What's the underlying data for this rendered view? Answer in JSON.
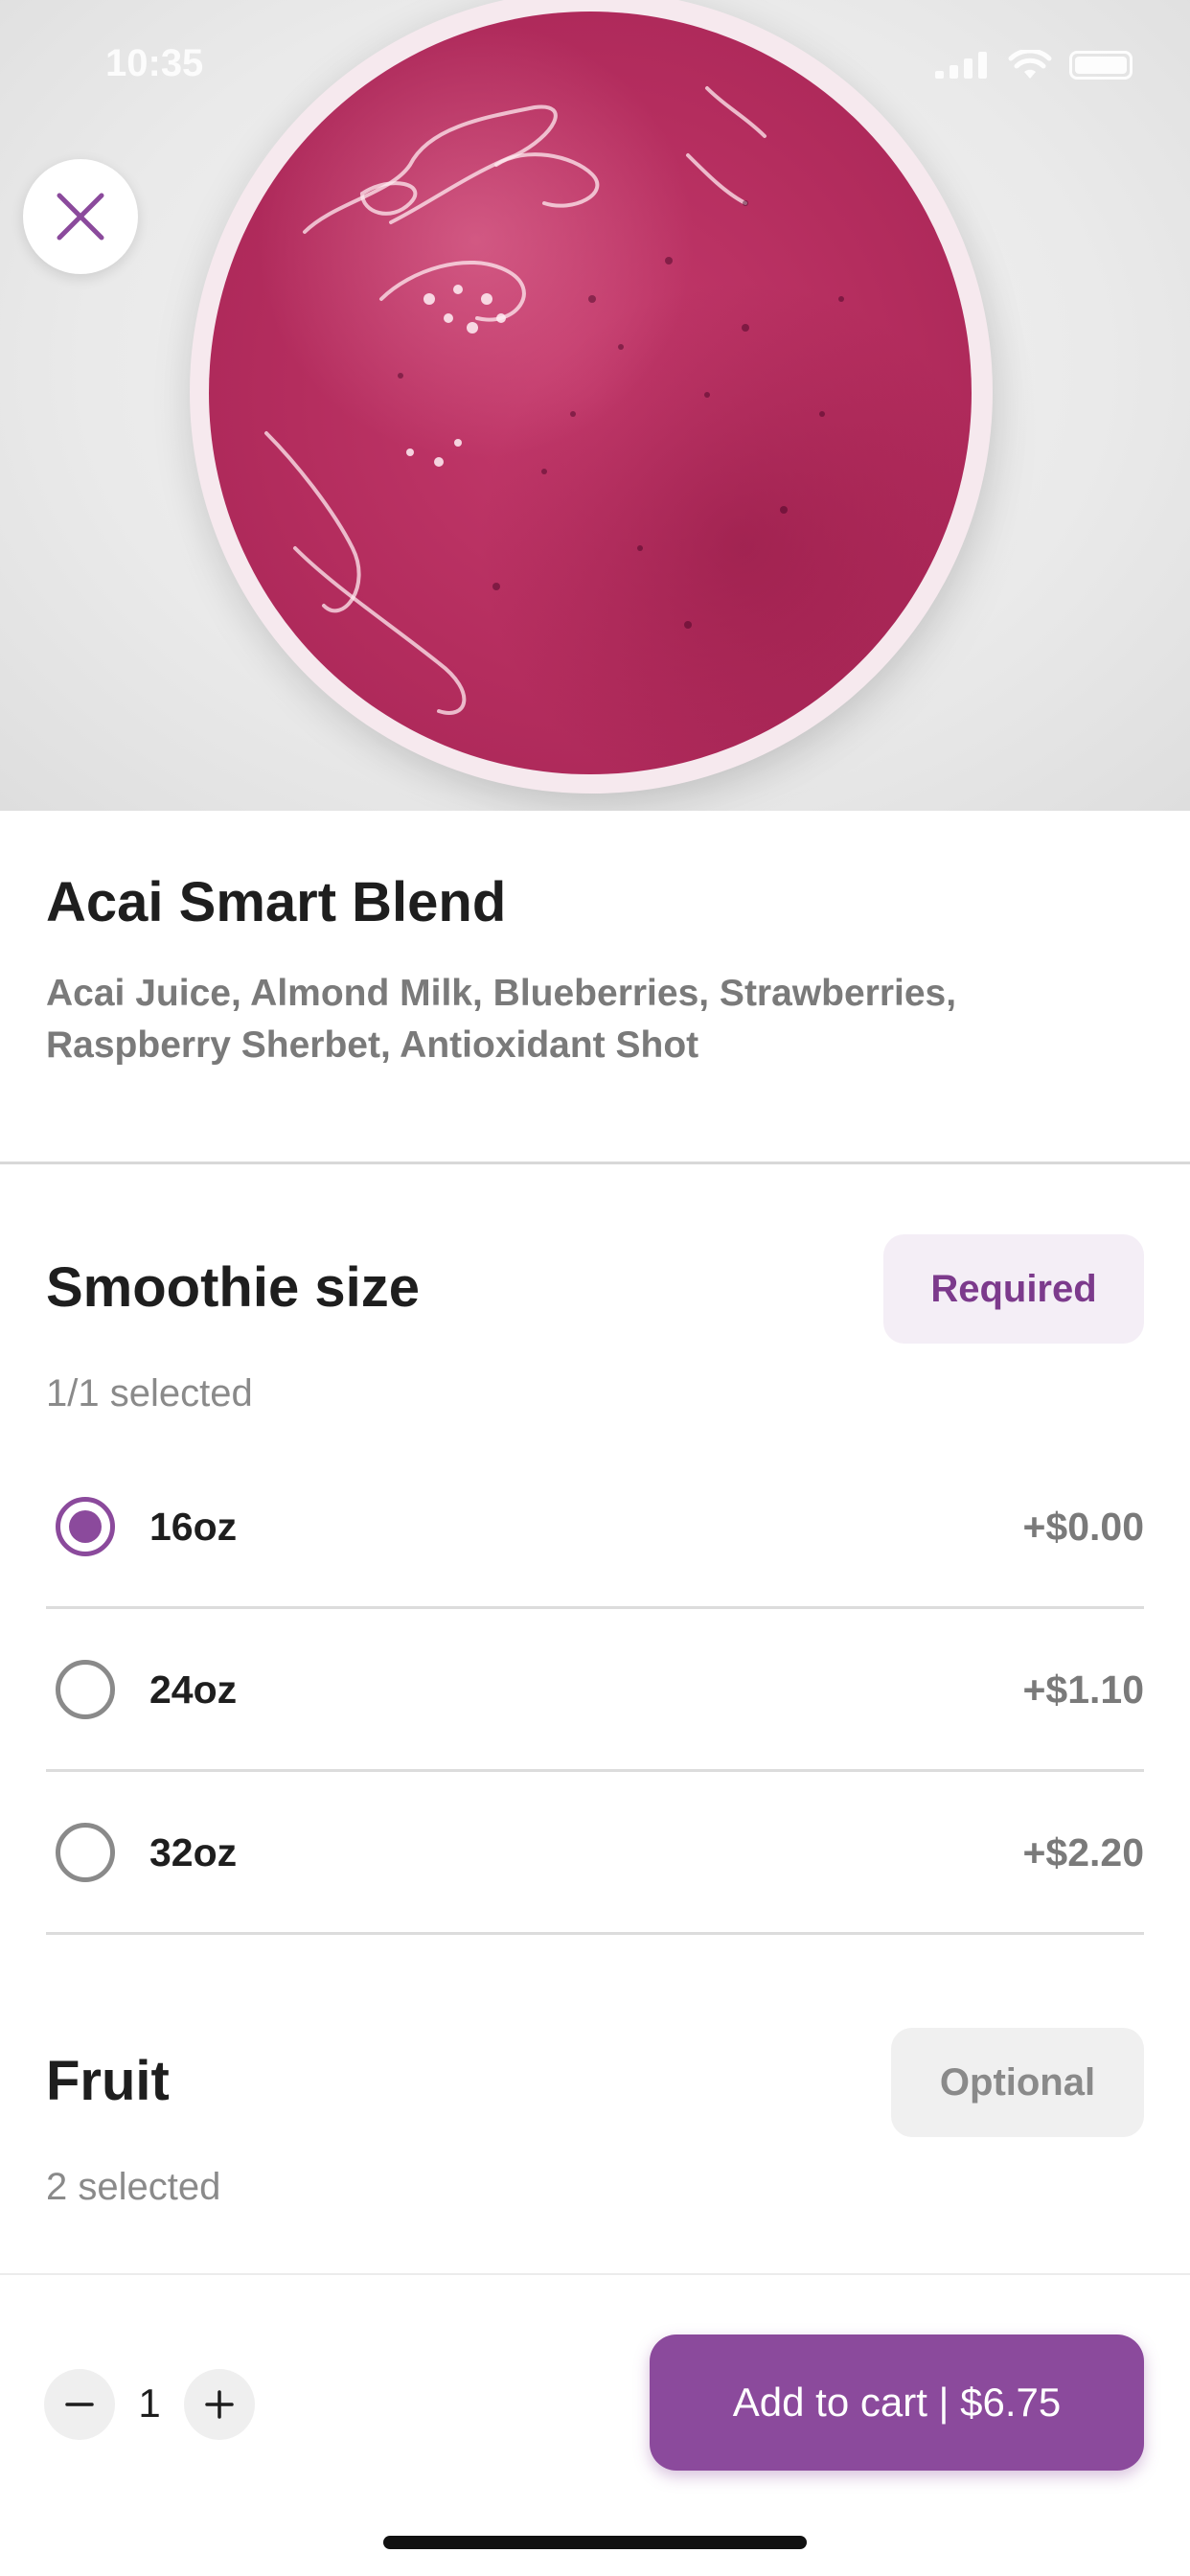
{
  "status_bar": {
    "time": "10:35"
  },
  "hero": {
    "image_description_icon": "smoothie-cup-top-view",
    "close_icon": "close-icon"
  },
  "product": {
    "title": "Acai Smart Blend",
    "description": "Acai Juice, Almond Milk, Blueberries, Strawberries, Raspberry Sherbet, Antioxidant Shot"
  },
  "size_section": {
    "title": "Smoothie size",
    "badge": "Required",
    "selected_count": "1/1 selected",
    "options": [
      {
        "name": "16oz",
        "price": "+$0.00",
        "selected": true
      },
      {
        "name": "24oz",
        "price": "+$1.10",
        "selected": false
      },
      {
        "name": "32oz",
        "price": "+$2.20",
        "selected": false
      }
    ]
  },
  "fruit_section": {
    "title": "Fruit",
    "badge": "Optional",
    "selected_count": "2 selected"
  },
  "bottom_bar": {
    "quantity": "1",
    "add_to_cart_label": "Add to cart | $6.75"
  },
  "colors": {
    "accent": "#8b4a9c",
    "required_badge_bg": "#f4eef6",
    "optional_badge_bg": "#f0f0f0"
  }
}
